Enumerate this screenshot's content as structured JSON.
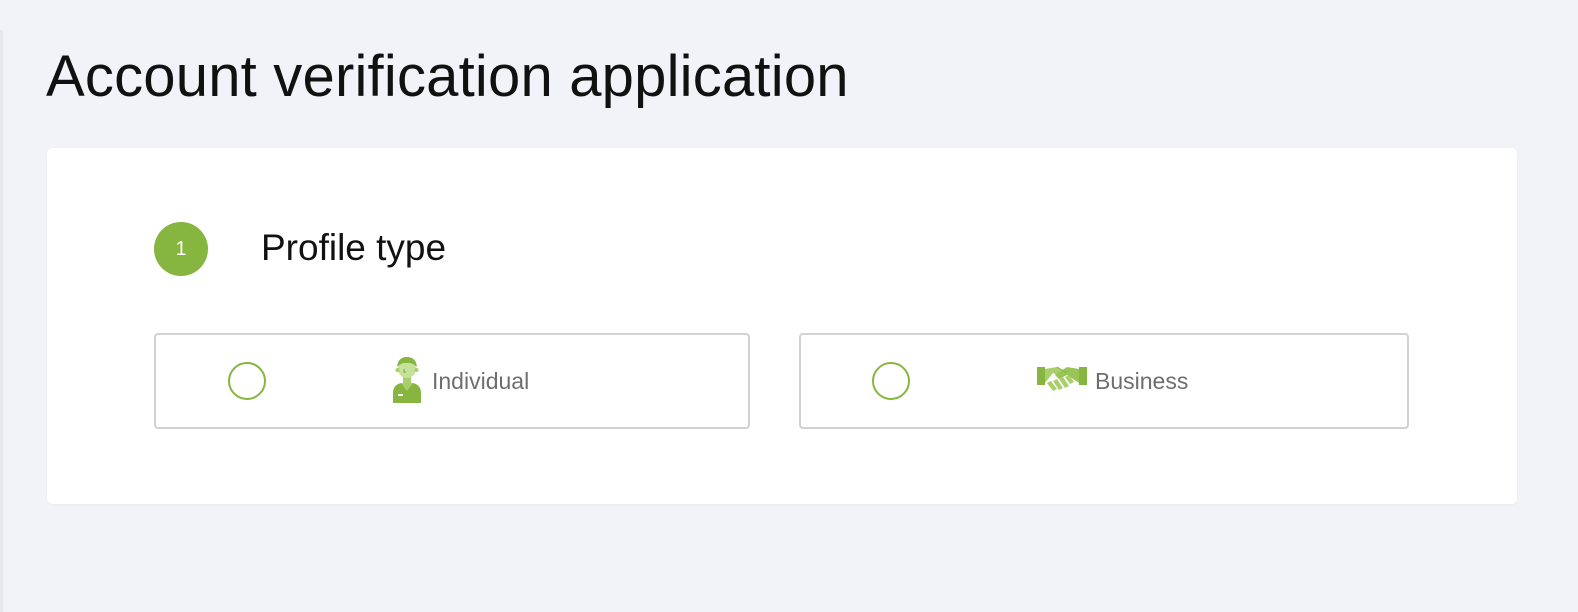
{
  "page": {
    "title": "Account verification application"
  },
  "step": {
    "number": "1",
    "title": "Profile type"
  },
  "options": [
    {
      "label": "Individual",
      "icon": "person-icon",
      "selected": false
    },
    {
      "label": "Business",
      "icon": "handshake-icon",
      "selected": false
    }
  ],
  "colors": {
    "accent": "#86b540",
    "background": "#f1f3f8",
    "card": "#ffffff",
    "border": "#d2d2d2",
    "label": "#6e6e6e"
  }
}
